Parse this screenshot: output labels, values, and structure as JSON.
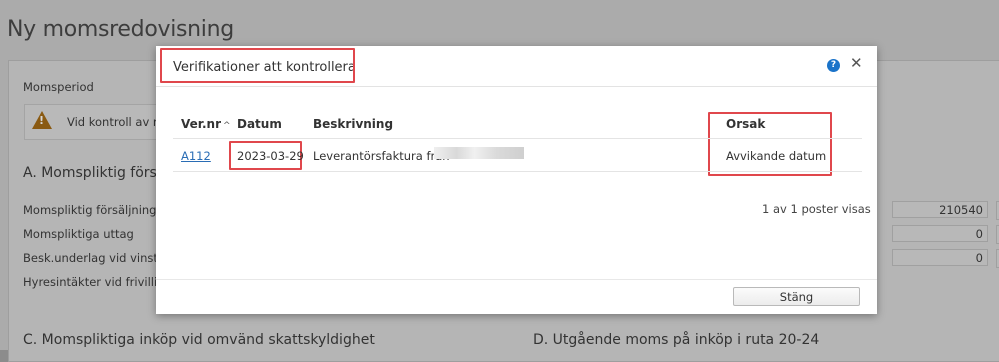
{
  "background": {
    "page_title": "Ny momsredovisning",
    "period_label": "Momsperiod",
    "warning_text": "Vid kontroll av mom",
    "section_a": "A. Momspliktig försäljn",
    "rows": [
      {
        "label": "Momspliktig försäljning som",
        "value": "210540"
      },
      {
        "label": "Momspliktiga uttag",
        "value": "0"
      },
      {
        "label": "Besk.underlag vid vinstmarg",
        "value": "0"
      },
      {
        "label": "Hyresintäkter vid frivillig be",
        "value": ""
      }
    ],
    "section_c": "C. Momspliktiga inköp vid omvänd skattskyldighet",
    "section_d": "D. Utgående moms på inköp i ruta 20-24"
  },
  "modal": {
    "title": "Verifikationer att kontrollera",
    "columns": {
      "ver_nr": "Ver.nr",
      "sort_indicator": "^",
      "datum": "Datum",
      "beskrivning": "Beskrivning",
      "orsak": "Orsak"
    },
    "rows": [
      {
        "ver_nr": "A112",
        "datum": "2023-03-29",
        "beskrivning": "Leverantörsfaktura från",
        "orsak": "Avvikande datum"
      }
    ],
    "record_count": "1 av 1 poster visas",
    "close_button": "Stäng"
  },
  "colors": {
    "highlight": "#e0474c",
    "link": "#2a6db5",
    "help": "#1a73c9"
  }
}
